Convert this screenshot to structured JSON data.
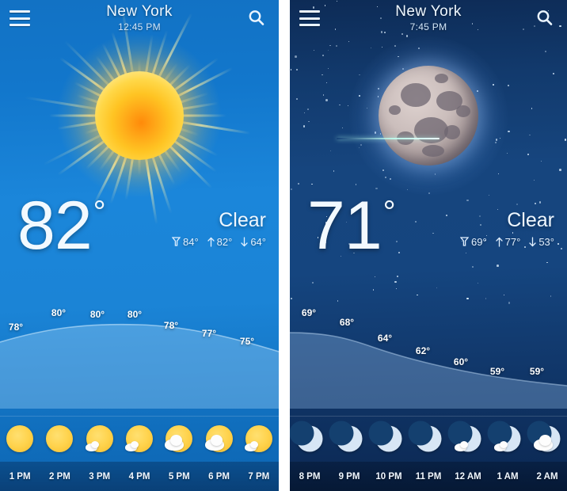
{
  "panels": [
    {
      "id": "day",
      "header": {
        "city": "New York",
        "time": "12:45 PM",
        "menu_icon": "hamburger-menu-icon",
        "search_icon": "search-icon"
      },
      "hero_icon": "sun-icon",
      "current": {
        "temperature": "82",
        "degree": "°",
        "condition": "Clear",
        "feels_like": "84°",
        "high": "82°",
        "low": "64°",
        "feels_like_icon": "thermometer-icon",
        "high_icon": "arrow-up-icon",
        "low_icon": "arrow-down-icon"
      },
      "chart_data": {
        "type": "line",
        "title": "Hourly temperature",
        "categories": [
          "1 PM",
          "2 PM",
          "3 PM",
          "4 PM",
          "5 PM",
          "6 PM",
          "7 PM"
        ],
        "values": [
          78,
          80,
          80,
          80,
          78,
          77,
          75
        ],
        "labels": [
          "78°",
          "80°",
          "80°",
          "80°",
          "78°",
          "77°",
          "75°"
        ],
        "ylabel": "",
        "xlabel": "",
        "ylim": [
          70,
          85
        ],
        "grid": false,
        "legend": "none"
      },
      "hourly": [
        {
          "time": "1 PM",
          "temp": "78°",
          "icon": "sunny-icon"
        },
        {
          "time": "2 PM",
          "temp": "80°",
          "icon": "sunny-icon"
        },
        {
          "time": "3 PM",
          "temp": "80°",
          "icon": "sun-small-cloud-icon"
        },
        {
          "time": "4 PM",
          "temp": "80°",
          "icon": "sun-small-cloud-icon"
        },
        {
          "time": "5 PM",
          "temp": "78°",
          "icon": "sun-cloud-icon"
        },
        {
          "time": "6 PM",
          "temp": "77°",
          "icon": "sun-cloud-icon"
        },
        {
          "time": "7 PM",
          "temp": "75°",
          "icon": "sun-small-cloud-icon"
        }
      ]
    },
    {
      "id": "night",
      "header": {
        "city": "New York",
        "time": "7:45 PM",
        "menu_icon": "hamburger-menu-icon",
        "search_icon": "search-icon"
      },
      "hero_icon": "full-moon-icon",
      "current": {
        "temperature": "71",
        "degree": "°",
        "condition": "Clear",
        "feels_like": "69°",
        "high": "77°",
        "low": "53°",
        "feels_like_icon": "thermometer-icon",
        "high_icon": "arrow-up-icon",
        "low_icon": "arrow-down-icon"
      },
      "chart_data": {
        "type": "line",
        "title": "Hourly temperature",
        "categories": [
          "8 PM",
          "9 PM",
          "10 PM",
          "11 PM",
          "12 AM",
          "1 AM",
          "2 AM"
        ],
        "values": [
          69,
          68,
          64,
          62,
          60,
          59,
          59
        ],
        "labels": [
          "69°",
          "68°",
          "64°",
          "62°",
          "60°",
          "59°",
          "59°"
        ],
        "ylabel": "",
        "xlabel": "",
        "ylim": [
          55,
          72
        ],
        "grid": false,
        "legend": "none"
      },
      "hourly": [
        {
          "time": "8 PM",
          "temp": "69°",
          "icon": "moon-icon"
        },
        {
          "time": "9 PM",
          "temp": "68°",
          "icon": "moon-icon"
        },
        {
          "time": "10 PM",
          "temp": "64°",
          "icon": "moon-icon"
        },
        {
          "time": "11 PM",
          "temp": "62°",
          "icon": "moon-icon"
        },
        {
          "time": "12 AM",
          "temp": "60°",
          "icon": "moon-small-cloud-icon"
        },
        {
          "time": "1 AM",
          "temp": "59°",
          "icon": "moon-small-cloud-icon"
        },
        {
          "time": "2 AM",
          "temp": "59°",
          "icon": "moon-cloud-icon"
        }
      ]
    }
  ],
  "colors": {
    "day_sky": "#1b86da",
    "night_sky": "#16457e",
    "sun": "#ffc423",
    "moon": "#d7e6f5",
    "text": "#eef7ff",
    "divider": "#ffffff"
  }
}
